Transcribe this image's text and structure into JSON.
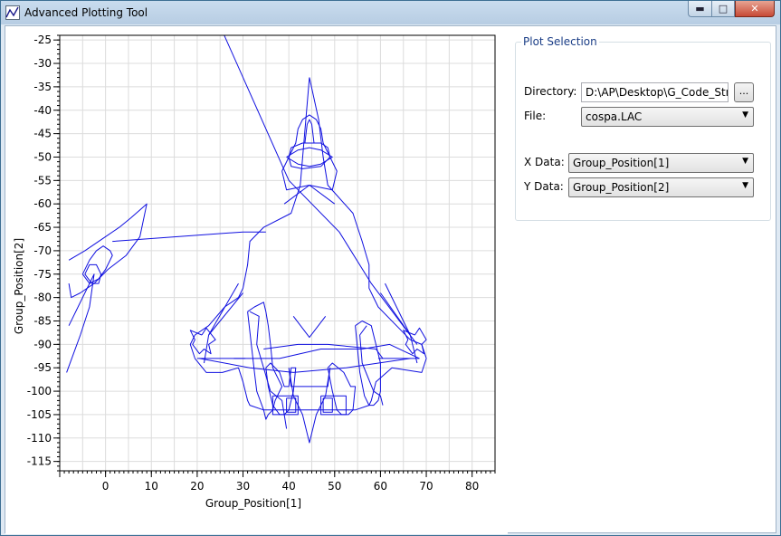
{
  "window": {
    "title": "Advanced Plotting Tool"
  },
  "panel": {
    "title": "Plot Selection",
    "directory_label": "Directory:",
    "directory_value": "D:\\AP\\Desktop\\G_Code_Strea",
    "browse_label": "...",
    "file_label": "File:",
    "file_value": "cospa.LAC",
    "xdata_label": "X Data:",
    "xdata_value": "Group_Position[1]",
    "ydata_label": "Y Data:",
    "ydata_value": "Group_Position[2]"
  },
  "chart_data": {
    "type": "line",
    "xlabel": "Group_Position[1]",
    "ylabel": "Group_Position[2]",
    "xlim": [
      -10,
      85
    ],
    "ylim": [
      -117,
      -24
    ],
    "xticks": [
      0,
      10,
      20,
      30,
      40,
      50,
      60,
      70,
      80
    ],
    "yticks": [
      -25,
      -30,
      -35,
      -40,
      -45,
      -50,
      -55,
      -60,
      -65,
      -70,
      -75,
      -80,
      -85,
      -90,
      -95,
      -100,
      -105,
      -110,
      -115
    ],
    "grid": true,
    "color": "#1010e0",
    "series": [
      {
        "x": [
          44.5,
          46.5,
          47.5,
          48.5,
          54.0,
          55.0,
          56.0,
          57.5,
          57.5,
          58.5,
          59.5,
          63.5,
          66.5,
          69.0,
          70.0,
          69.0,
          62.5,
          59.0,
          58.0,
          57.5,
          54.5,
          44.5,
          34.5,
          31.5,
          31.0,
          30.0,
          29.0,
          25.5,
          22.0,
          19.5,
          18.5,
          19.5,
          22.5,
          26.0,
          29.0,
          30.0,
          31.0,
          31.5,
          34.5,
          40.5,
          42.5,
          44.5
        ],
        "y": [
          -33,
          -42,
          -50,
          -56,
          -62,
          -65,
          -68,
          -73,
          -78,
          -80,
          -82,
          -86,
          -89,
          -90,
          -93,
          -96,
          -95,
          -98,
          -102,
          -103,
          -104,
          -104,
          -104,
          -103,
          -102,
          -98,
          -95,
          -96,
          -96,
          -93,
          -90,
          -88,
          -86,
          -82,
          -80,
          -78,
          -73,
          -68,
          -65,
          -62,
          -56,
          -33
        ]
      },
      {
        "x": [
          39.0,
          44.5,
          50.0
        ],
        "y": [
          -60,
          -56,
          -60
        ]
      },
      {
        "x": [
          38.5,
          41.5,
          42.0,
          42.5,
          43.0,
          44.5,
          46.0,
          46.5,
          47.0,
          47.5,
          50.5,
          49.5,
          44.5,
          39.5,
          38.5
        ],
        "y": [
          -53,
          -47,
          -44,
          -43,
          -42,
          -41,
          -42,
          -43,
          -44,
          -47,
          -53,
          -57,
          -56,
          -57,
          -53
        ]
      },
      {
        "x": [
          39.5,
          42.0,
          44.5,
          47.0,
          49.5,
          47.0,
          44.5,
          42.0,
          39.5
        ],
        "y": [
          -50,
          -48.5,
          -48,
          -48.5,
          -50,
          -51.5,
          -52,
          -51.5,
          -50
        ]
      },
      {
        "x": [
          40.0,
          40.5,
          43.0,
          47.0,
          48.5,
          49.0,
          47.0,
          43.0,
          40.5,
          40.0
        ],
        "y": [
          -50,
          -48,
          -47,
          -47,
          -48,
          -50,
          -52,
          -52.5,
          -52,
          -50
        ]
      },
      {
        "x": [
          43.5,
          44.0,
          44.5,
          45.0,
          45.5
        ],
        "y": [
          -47,
          -43,
          -42,
          -43,
          -47
        ]
      },
      {
        "x": [
          31.0,
          32.5,
          34.5,
          35.0,
          35.5,
          36.0,
          36.5,
          38.5,
          38.0,
          37.0,
          36.5,
          35.5,
          35.0,
          34.5,
          33.0,
          32.5,
          31.0
        ],
        "y": [
          -83,
          -82,
          -81,
          -83,
          -86,
          -90,
          -95,
          -99,
          -100,
          -102,
          -104,
          -105,
          -106,
          -104,
          -100,
          -96,
          -83
        ]
      },
      {
        "x": [
          54.5,
          56.0,
          58.0,
          58.5,
          59.0,
          59.5,
          60.0,
          60.0,
          59.5,
          58.5,
          57.5,
          56.5,
          55.5,
          54.5
        ],
        "y": [
          -86,
          -85,
          -86,
          -88,
          -90,
          -92,
          -94,
          -100,
          -102,
          -103,
          -103,
          -101,
          -96,
          -86
        ]
      },
      {
        "x": [
          31.5,
          33.5,
          33.0,
          36.0,
          38.5,
          39.5
        ],
        "y": [
          -83,
          -84,
          -90,
          -100,
          -102,
          -108
        ]
      },
      {
        "x": [
          57.0,
          55.5,
          56.0,
          58.5,
          60.0,
          60.5
        ],
        "y": [
          -86,
          -88,
          -94,
          -100,
          -101,
          -103
        ]
      },
      {
        "x": [
          41.0,
          44.5,
          48.0
        ],
        "y": [
          -84,
          -88.5,
          -84
        ]
      },
      {
        "x": [
          40.0,
          40.5,
          44.5,
          48.5,
          49.0,
          48.0,
          46.0,
          44.5,
          43.0,
          41.0,
          40.0
        ],
        "y": [
          -95,
          -99,
          -99,
          -99,
          -95,
          -101,
          -105,
          -111,
          -105,
          -101,
          -95
        ]
      },
      {
        "x": [
          35.0,
          36.0,
          38.0,
          39.0,
          40.0,
          40.5,
          41.5,
          41.0,
          40.0,
          39.0,
          38.0,
          36.5,
          35.5,
          35.0
        ],
        "y": [
          -95,
          -94,
          -96,
          -99,
          -99,
          -95,
          -95,
          -100,
          -104,
          -105,
          -105,
          -103,
          -99,
          -95
        ]
      },
      {
        "x": [
          48.5,
          49.5,
          52.0,
          53.5,
          54.5,
          54.0,
          53.0,
          51.5,
          50.5,
          49.5,
          48.5
        ],
        "y": [
          -95,
          -94,
          -96,
          -99,
          -99,
          -104,
          -105,
          -105,
          -104,
          -100,
          -95
        ]
      },
      {
        "x": [
          36.5,
          42.0,
          42.0,
          36.5,
          36.5
        ],
        "y": [
          -101,
          -101,
          -105,
          -105,
          -101
        ]
      },
      {
        "x": [
          47.0,
          52.5,
          52.5,
          47.0,
          47.0
        ],
        "y": [
          -101,
          -101,
          -105,
          -105,
          -101
        ]
      },
      {
        "x": [
          39.5,
          41.5,
          41.5,
          39.5,
          39.5
        ],
        "y": [
          -101.5,
          -101.5,
          -104.5,
          -104.5,
          -101.5
        ]
      },
      {
        "x": [
          47.5,
          49.5,
          49.5,
          47.5,
          47.5
        ],
        "y": [
          -101.5,
          -101.5,
          -104.5,
          -104.5,
          -101.5
        ]
      },
      {
        "x": [
          20.0,
          30.5
        ],
        "y": [
          -93,
          -93
        ]
      },
      {
        "x": [
          59.5,
          68.5
        ],
        "y": [
          -93,
          -93
        ]
      },
      {
        "x": [
          21.0,
          22.0,
          24.0,
          22.5,
          23.0,
          21.5,
          20.5,
          19.0,
          19.5,
          18.5,
          21.0
        ],
        "y": [
          -88,
          -86.5,
          -89,
          -90,
          -92,
          -91,
          -92,
          -90,
          -89,
          -87,
          -88
        ]
      },
      {
        "x": [
          67.5,
          68.5,
          70.0,
          69.0,
          69.5,
          68.0,
          67.0,
          65.5,
          66.0,
          65.0,
          67.5
        ],
        "y": [
          -88,
          -86.5,
          -89,
          -90,
          -92,
          -91,
          -92,
          -90,
          -89,
          -87,
          -88
        ]
      },
      {
        "x": [
          29.0,
          22.5,
          21.5
        ],
        "y": [
          -77,
          -88,
          -94
        ]
      },
      {
        "x": [
          30.0,
          22.5
        ],
        "y": [
          -79,
          -88
        ]
      },
      {
        "x": [
          61.0,
          66.5,
          68.0
        ],
        "y": [
          -77,
          -88,
          -94
        ]
      },
      {
        "x": [
          60.0,
          66.5
        ],
        "y": [
          -79,
          -88
        ]
      },
      {
        "x": [
          -8.0,
          -4.5,
          0.0,
          3.0,
          5.5,
          9.0,
          7.5,
          4.5,
          0.5,
          -2.5,
          -5.5,
          -7.5,
          -8.0
        ],
        "y": [
          -72,
          -70,
          -67,
          -65,
          -63,
          -60,
          -67,
          -71,
          -74,
          -77,
          -79,
          -80,
          -77
        ]
      },
      {
        "x": [
          -5.0,
          -3.5,
          -2.0,
          -0.5,
          1.0,
          1.5,
          0.0,
          -1.5,
          -3.5,
          -5.0
        ],
        "y": [
          -75,
          -72,
          -70,
          -69,
          -70,
          -71,
          -74,
          -76,
          -77,
          -75
        ]
      },
      {
        "x": [
          -4.5,
          -3.5,
          -2.0,
          -1.0,
          -1.5,
          -3.0,
          -4.5
        ],
        "y": [
          -75,
          -73,
          -73,
          -75,
          -77,
          -77,
          -75
        ]
      },
      {
        "x": [
          1.5,
          30.0,
          35.0
        ],
        "y": [
          -68,
          -66,
          -66
        ]
      },
      {
        "x": [
          -8.0,
          -5.0,
          -2.5,
          -3.5,
          -5.5,
          -8.5
        ],
        "y": [
          -86,
          -80,
          -75,
          -82,
          -88,
          -96
        ]
      },
      {
        "x": [
          34.5,
          42.0,
          48.5,
          59.0,
          60.5
        ],
        "y": [
          -91,
          -90,
          -90,
          -91,
          -93
        ]
      },
      {
        "x": [
          28.0,
          38.0,
          47.0,
          56.0,
          62.0,
          68.5
        ],
        "y": [
          -93,
          -93,
          -91,
          -91,
          -90,
          -93
        ]
      },
      {
        "x": [
          20.5,
          31.5,
          41.0,
          52.5,
          66.5
        ],
        "y": [
          -93,
          -95,
          -96,
          -95,
          -93
        ]
      },
      {
        "x": [
          25.0,
          40.0,
          51.0,
          58.0,
          68.0
        ],
        "y": [
          -22,
          -55,
          -66,
          -77,
          -90
        ]
      }
    ]
  }
}
